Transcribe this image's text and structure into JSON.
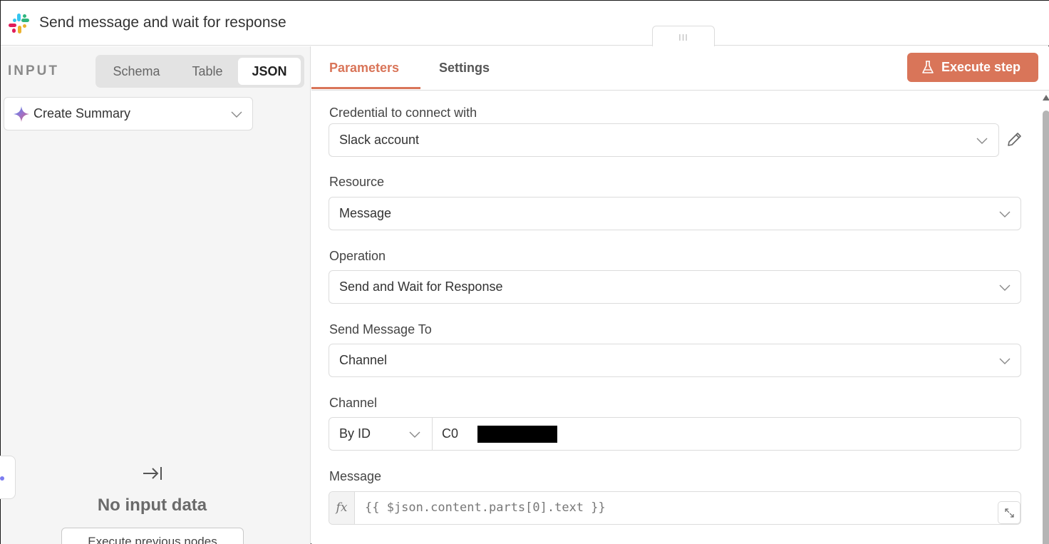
{
  "header": {
    "title": "Send message and wait for response",
    "logo_icon": "slack-logo",
    "drag_handle_glyph": "III"
  },
  "input_panel": {
    "label": "INPUT",
    "views": [
      "Schema",
      "Table",
      "JSON"
    ],
    "active_view": "JSON",
    "source_node": "Create Summary",
    "empty_title": "No input data",
    "execute_previous_label": "Execute previous nodes"
  },
  "tabs": {
    "items": [
      "Parameters",
      "Settings"
    ],
    "active": "Parameters"
  },
  "execute_step": {
    "label": "Execute step",
    "icon": "flask-icon"
  },
  "params": {
    "credential": {
      "label": "Credential to connect with",
      "value": "Slack account"
    },
    "resource": {
      "label": "Resource",
      "value": "Message"
    },
    "operation": {
      "label": "Operation",
      "value": "Send and Wait for Response"
    },
    "send_to": {
      "label": "Send Message To",
      "value": "Channel"
    },
    "channel": {
      "label": "Channel",
      "mode": "By ID",
      "value": "C0"
    },
    "message": {
      "label": "Message",
      "fx": "fx",
      "value": "{{ $json.content.parts[0].text }}"
    }
  },
  "colors": {
    "accent": "#d97559",
    "panel_bg": "#f5f5f5",
    "border": "#dcdcdc"
  }
}
